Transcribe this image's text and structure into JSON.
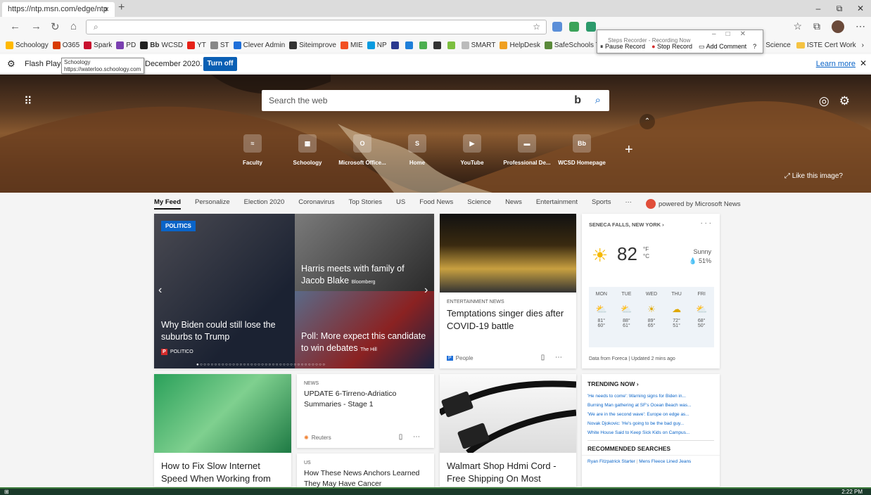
{
  "browser": {
    "tab_title": "https://ntp.msn.com/edge/ntp",
    "tab_close": "×",
    "new_tab": "+",
    "window_controls": [
      "–",
      "⧉",
      "✕"
    ],
    "url_placeholder": "",
    "nav": {
      "back": "←",
      "forward": "→",
      "refresh": "↻",
      "home": "⌂"
    }
  },
  "favorites": [
    {
      "label": "Schoology",
      "color": "#ffb900"
    },
    {
      "label": "O365",
      "color": "#d83b01"
    },
    {
      "label": "Spark",
      "color": "#c8102e"
    },
    {
      "label": "PD",
      "color": "#7a3fb0"
    },
    {
      "label": "WCSD",
      "color": "#222222",
      "prefix": "Bb"
    },
    {
      "label": "YT",
      "color": "#e62117"
    },
    {
      "label": "ST",
      "color": "#888888"
    },
    {
      "label": "Clever Admin",
      "color": "#1e6fd9"
    },
    {
      "label": "Siteimprove",
      "color": "#333333"
    },
    {
      "label": "MIE",
      "color": "#f25022"
    },
    {
      "label": "NP",
      "color": "#0a9be0"
    },
    {
      "label": "",
      "color": "#2b3990"
    },
    {
      "label": "",
      "color": "#1e7fd9"
    },
    {
      "label": "",
      "color": "#4caf50"
    },
    {
      "label": "",
      "color": "#333333"
    },
    {
      "label": "",
      "color": "#7cbf3f"
    },
    {
      "label": "SMART",
      "color": "#bbbbbb"
    },
    {
      "label": "HelpDesk",
      "color": "#f0a020"
    },
    {
      "label": "SafeSchools Trainin",
      "color": "#5a8a3a"
    }
  ],
  "favorites_right": [
    "Science",
    "ISTE Cert Work"
  ],
  "tooltip": {
    "line1": "Schoology",
    "line2": "https://waterloo.schoology.com"
  },
  "infobar": {
    "text_start": "Flash Player w",
    "text_end": "December 2020.",
    "button": "Turn off",
    "learn_more": "Learn more",
    "close": "✕"
  },
  "steps_recorder": {
    "title": "Steps Recorder - Recording Now",
    "controls": [
      "–",
      "□",
      "✕"
    ],
    "pause": "Pause Record",
    "stop": "Stop Record",
    "comment": "Add Comment",
    "help": "?"
  },
  "hero": {
    "search_placeholder": "Search the web",
    "bing_glyph": "b",
    "like_image": "Like this image?",
    "quick_links": [
      {
        "label": "Faculty",
        "glyph": "≈"
      },
      {
        "label": "Schoology",
        "glyph": "▦"
      },
      {
        "label": "Microsoft Office...",
        "glyph": "O"
      },
      {
        "label": "Home",
        "glyph": "S"
      },
      {
        "label": "YouTube",
        "glyph": "▶"
      },
      {
        "label": "Professional De...",
        "glyph": "▬"
      },
      {
        "label": "WCSD Homepage",
        "glyph": "Bb"
      }
    ]
  },
  "feed_nav": {
    "items": [
      "My Feed",
      "Personalize",
      "Election 2020",
      "Coronavirus",
      "Top Stories",
      "US",
      "Food News",
      "Science",
      "News",
      "Entertainment",
      "Sports",
      "···"
    ],
    "powered": "powered by Microsoft News"
  },
  "carousel": {
    "tag": "POLITICS",
    "main_headline": "Why Biden could still lose the suburbs to Trump",
    "main_source": "POLITICO",
    "story2_headline": "Harris meets with family of Jacob Blake",
    "story2_source": "Bloomberg",
    "story3_headline": "Poll: More expect this candidate to win debates",
    "story3_source": "The Hill",
    "dots": "●○○○○○○○○○○○○○○○○○○○○○○○○○○○○○○○○○○○"
  },
  "temptations": {
    "category": "ENTERTAINMENT NEWS",
    "headline": "Temptations singer dies after COVID-19 battle",
    "source": "People"
  },
  "weather": {
    "location": "SENECA FALLS, NEW YORK  ›",
    "more": "· · ·",
    "temp": "82",
    "unit_f": "°F",
    "unit_c": "°C",
    "condition": "Sunny",
    "precip": "💧 51%",
    "forecast": [
      {
        "day": "MON",
        "hi": "81°",
        "lo": "60°",
        "icon": "⛅"
      },
      {
        "day": "TUE",
        "hi": "88°",
        "lo": "61°",
        "icon": "⛅"
      },
      {
        "day": "WED",
        "hi": "89°",
        "lo": "65°",
        "icon": "☀"
      },
      {
        "day": "THU",
        "hi": "72°",
        "lo": "51°",
        "icon": "☁"
      },
      {
        "day": "FRI",
        "hi": "68°",
        "lo": "50°",
        "icon": "⛅"
      }
    ],
    "footer": "Data from Foreca | Updated 2 mins ago"
  },
  "laptop": {
    "headline": "How to Fix Slow Internet Speed When Working from"
  },
  "tirreno": {
    "category": "NEWS",
    "headline": "UPDATE 6-Tirreno-Adriatico Summaries - Stage 1",
    "source": "Reuters"
  },
  "anchors": {
    "category": "US",
    "headline": "How These News Anchors Learned They May Have Cancer"
  },
  "hdmi": {
    "headline": "Walmart Shop Hdmi Cord - Free Shipping On Most"
  },
  "trending": {
    "title": "TRENDING NOW  ›",
    "items": [
      "'He needs to come': Warning signs for Biden in...",
      "Burning Man gathering at SF's Ocean Beach was...",
      "'We are in the second wave': Europe on edge as...",
      "Novak Djokovic: 'He's going to be the bad guy...",
      "White House Said to Keep Sick Kids on Campus..."
    ],
    "rec_title": "RECOMMENDED SEARCHES",
    "rec_items": [
      "Ryan Fitzpatrick Starter",
      "Mens Fleece Lined Jeans"
    ]
  },
  "taskbar": {
    "time": "2:22 PM"
  }
}
